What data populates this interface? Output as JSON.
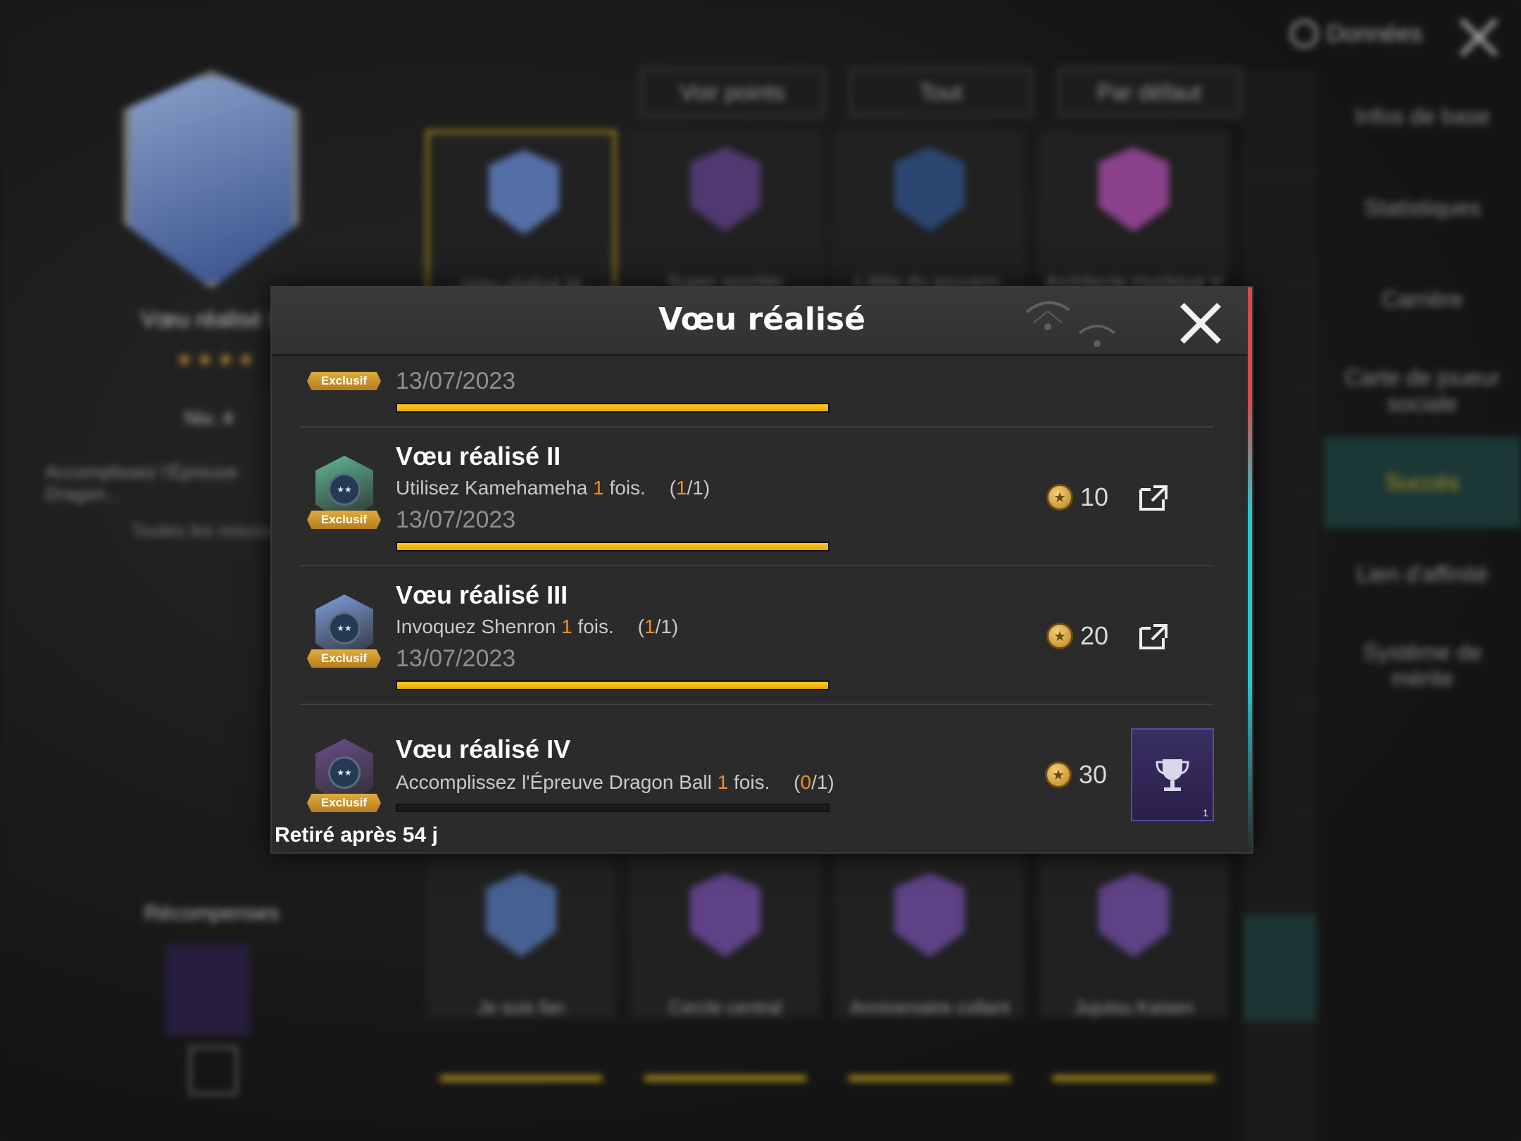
{
  "background": {
    "top_label": "Données",
    "left_title": "Vœu réalisé III",
    "left_stars": "★★★★",
    "left_level": "Niv. 4",
    "left_desc": "Accomplissez l'Épreuve Dragon...",
    "left_all": "Toutes les missions",
    "rewards_label": "Récompenses",
    "filters": [
      "Voir points",
      "Tout",
      "Par défaut"
    ],
    "top_cards": [
      "Vœu réalisé III",
      "Super sportier",
      "L'élite du gouvern.",
      "Architecte mystique V"
    ],
    "bottom_cards": [
      "Je suis fan",
      "Cercle central",
      "Anniversaire collant",
      "Jujutsu Kaisen"
    ],
    "side_menu": [
      "Infos de base",
      "Statistiques",
      "Carrière",
      "Carte de joueur sociale",
      "Succès",
      "Lien d'affinité",
      "Système de mérite"
    ]
  },
  "modal": {
    "title": "Vœu réalisé",
    "footer": "Retiré après 54 j",
    "partial_date": "13/07/2023",
    "partial_badge": "Exclusif",
    "rows": [
      {
        "title": "Vœu réalisé II",
        "desc_pre": "Utilisez Kamehameha ",
        "desc_count": "1",
        "desc_post": " fois.",
        "prog_open": "(",
        "prog_done": "1",
        "prog_close": "/1)",
        "date": "13/07/2023",
        "badge_label": "Exclusif",
        "badge_color": "#5fb895",
        "points": "10",
        "progress": 1.0
      },
      {
        "title": "Vœu réalisé III",
        "desc_pre": "Invoquez Shenron ",
        "desc_count": "1",
        "desc_post": " fois.",
        "prog_open": "(",
        "prog_done": "1",
        "prog_close": "/1)",
        "date": "13/07/2023",
        "badge_label": "Exclusif",
        "badge_color": "#7f9fe0",
        "points": "20",
        "progress": 1.0
      },
      {
        "title": "Vœu réalisé IV",
        "desc_pre": "Accomplissez l'Épreuve Dragon Ball ",
        "desc_count": "1",
        "desc_post": " fois.",
        "prog_open": "(",
        "prog_done": "0",
        "prog_close": "/1)",
        "badge_label": "Exclusif",
        "badge_color": "#6a4e8c",
        "points": "30",
        "progress": 0.0,
        "reward_count": "1"
      }
    ]
  },
  "colors": {
    "accent_gold": "#ffcb1f",
    "highlight_orange": "#ee8d27",
    "active_teal": "#1d3e3c"
  }
}
